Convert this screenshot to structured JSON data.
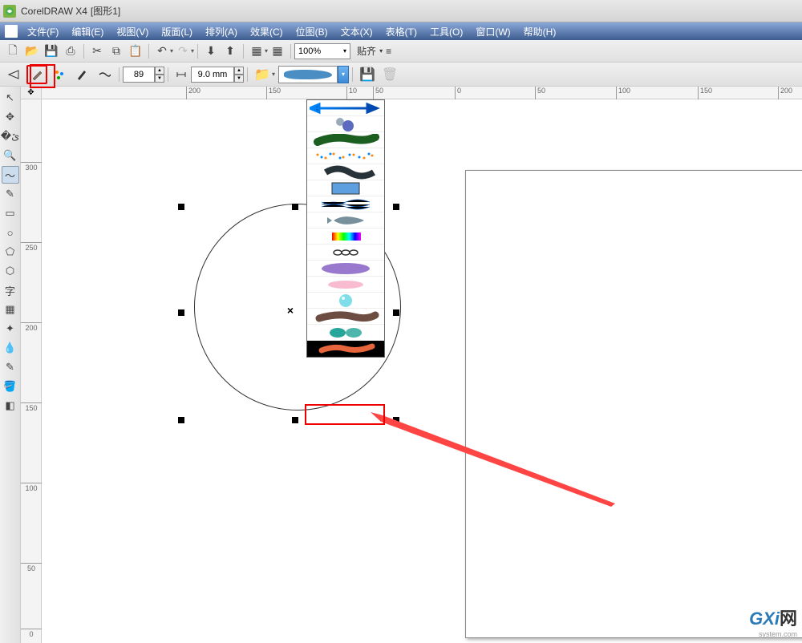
{
  "title": {
    "app": "CorelDRAW X4",
    "doc": "[图形1]"
  },
  "menu": {
    "file": "文件(F)",
    "edit": "编辑(E)",
    "view": "视图(V)",
    "layout": "版面(L)",
    "arrange": "排列(A)",
    "effects": "效果(C)",
    "bitmaps": "位图(B)",
    "text": "文本(X)",
    "table": "表格(T)",
    "tools": "工具(O)",
    "window": "窗口(W)",
    "help": "帮助(H)"
  },
  "toolbar": {
    "zoom": "100%",
    "snap_label": "贴齐"
  },
  "props": {
    "smooth_value": "89",
    "width_value": "9.0 mm"
  },
  "ruler_h": [
    {
      "pos": 180,
      "label": "200"
    },
    {
      "pos": 280,
      "label": "150"
    },
    {
      "pos": 380,
      "label": "10"
    },
    {
      "pos": 413,
      "label": "50"
    },
    {
      "pos": 515,
      "label": "0"
    },
    {
      "pos": 615,
      "label": "50"
    },
    {
      "pos": 716,
      "label": "100"
    },
    {
      "pos": 818,
      "label": "150"
    },
    {
      "pos": 918,
      "label": "200"
    }
  ],
  "ruler_v": [
    {
      "pos": 78,
      "label": "300"
    },
    {
      "pos": 178,
      "label": "250"
    },
    {
      "pos": 278,
      "label": "200"
    },
    {
      "pos": 378,
      "label": "150"
    },
    {
      "pos": 478,
      "label": "100"
    },
    {
      "pos": 578,
      "label": "50"
    },
    {
      "pos": 660,
      "label": "0"
    }
  ],
  "watermark": {
    "main": "GXi",
    "wang": "网",
    "sub": "system.com"
  },
  "icons": {
    "new": "🗋",
    "open": "📂",
    "save": "💾",
    "print": "⎙",
    "cut": "✂",
    "copy": "⧉",
    "paste": "📋",
    "undo": "↶",
    "redo": "↷",
    "import": "⬇",
    "export": "⬆",
    "app_launcher": "▦",
    "options": "⚙",
    "snap": "▦",
    "align": "≡",
    "preset": "▸",
    "brush_tool": "🖌",
    "spray": "✦",
    "calligraphic": "✒",
    "pressure": "〰",
    "folder": "📁",
    "disk": "💾",
    "trash": "🗑",
    "pick": "↖",
    "shape": "✥",
    "crop": "�ێ",
    "zoom_tool": "🔍",
    "freehand": "〜",
    "smart": "✎",
    "rect": "▭",
    "ellipse": "○",
    "polygon": "⬠",
    "basic_shapes": "⬡",
    "text_tool": "字",
    "table_tool": "▦",
    "interactive": "✦",
    "eyedropper": "💧",
    "outline": "✎",
    "fill_tool": "🪣",
    "ifill": "◧"
  }
}
